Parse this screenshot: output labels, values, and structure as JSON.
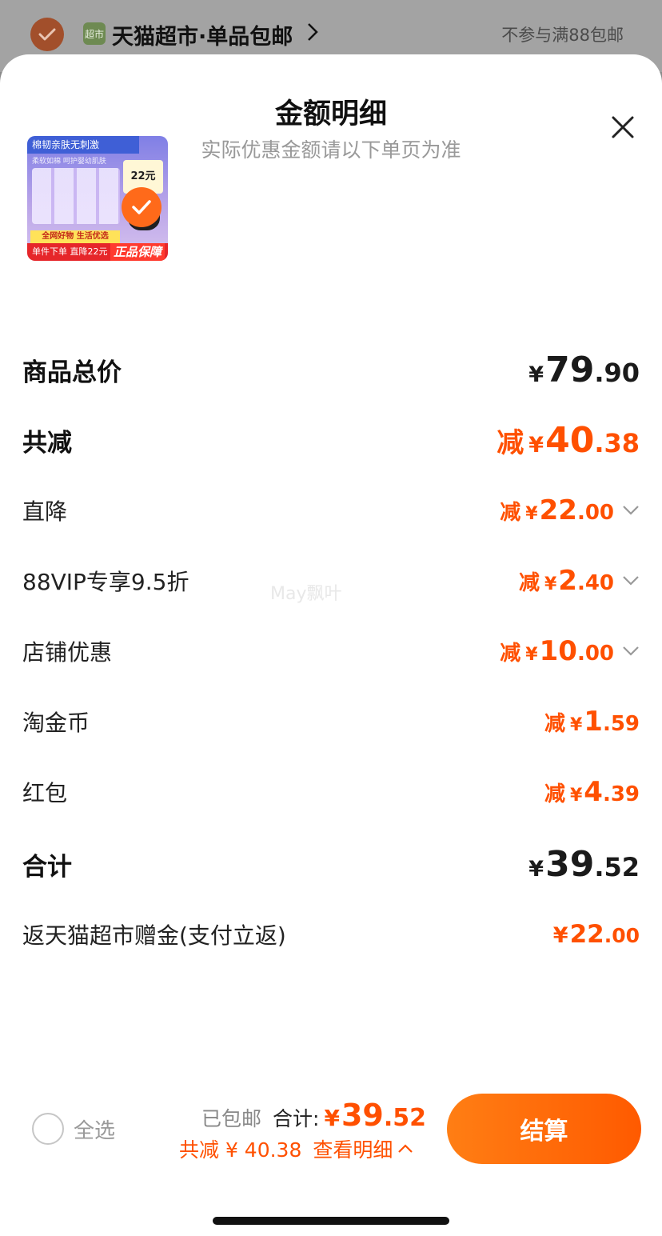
{
  "store": {
    "logo_text": "超市",
    "name": "天猫超市·单品包邮",
    "note": "不参与满88包邮"
  },
  "sheet": {
    "title": "金额明细",
    "subtitle": "实际优惠金额请以下单页为准"
  },
  "product": {
    "banner_text": "棉韧亲肤无刺激",
    "sub_text": "柔软如棉 呵护婴幼肌肤",
    "price_tag": "22元",
    "strip_text": "全网好物 生活优选",
    "bottom_text": "单件下单 直降22元",
    "badge_text": "正品保障"
  },
  "rows": [
    {
      "label": "商品总价",
      "prefix": "",
      "yen": "¥",
      "int": "79",
      "dec": ".90"
    },
    {
      "label": "共减",
      "prefix": "减",
      "yen": "¥",
      "int": "40",
      "dec": ".38"
    },
    {
      "label": "直降",
      "prefix": "减",
      "yen": "¥",
      "int": "22",
      "dec": ".00"
    },
    {
      "label": "88VIP专享9.5折",
      "prefix": "减",
      "yen": "¥",
      "int": "2",
      "dec": ".40"
    },
    {
      "label": "店铺优惠",
      "prefix": "减",
      "yen": "¥",
      "int": "10",
      "dec": ".00"
    },
    {
      "label": "淘金币",
      "prefix": "减",
      "yen": "¥",
      "int": "1",
      "dec": ".59"
    },
    {
      "label": "红包",
      "prefix": "减",
      "yen": "¥",
      "int": "4",
      "dec": ".39"
    },
    {
      "label": "合计",
      "prefix": "",
      "yen": "¥",
      "int": "39",
      "dec": ".52"
    },
    {
      "label": "返天猫超市赠金(支付立返)",
      "prefix": "",
      "yen": "¥",
      "int": "22",
      "dec": ".00"
    }
  ],
  "watermark": "May飘叶",
  "footer": {
    "select_all": "全选",
    "shipping": "已包邮",
    "total_label": "合计:",
    "total_yen": "¥",
    "total_int": "39",
    "total_dec": ".52",
    "saved": "共减 ¥ 40.38",
    "detail_link": "查看明细",
    "checkout": "结算"
  },
  "colors": {
    "accent": "#ff5000",
    "text": "#1a1a1a",
    "muted": "#999999"
  }
}
